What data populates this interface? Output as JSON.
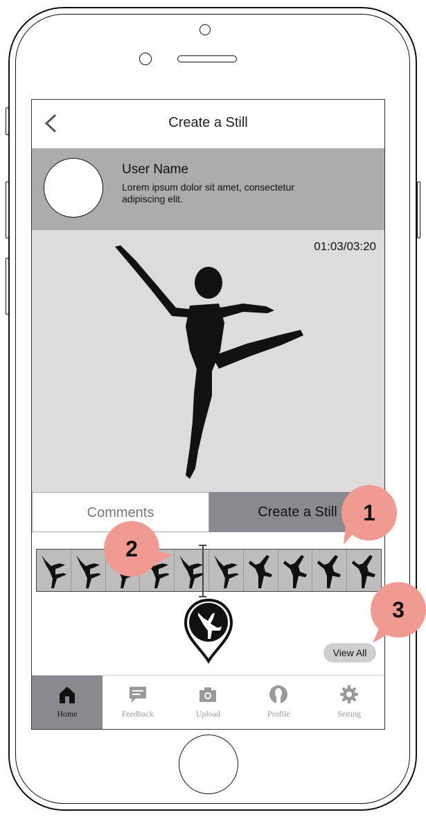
{
  "nav": {
    "title": "Create a Still",
    "back_icon": "chevron-left-icon"
  },
  "user": {
    "name": "User Name",
    "description": "Lorem ipsum dolor sit amet, consectetur adipiscing elit."
  },
  "video": {
    "timestamp": "01:03/03:20"
  },
  "tabs": [
    {
      "label": "Comments",
      "active": false
    },
    {
      "label": "Create a Still",
      "active": true
    }
  ],
  "filmstrip": {
    "frame_count": 10
  },
  "view_all": {
    "label": "View All"
  },
  "tabbar": [
    {
      "label": "Home",
      "icon": "home-icon",
      "active": true
    },
    {
      "label": "Feedback",
      "icon": "chat-bubble-icon",
      "active": false
    },
    {
      "label": "Upload",
      "icon": "camera-icon",
      "active": false
    },
    {
      "label": "Profile",
      "icon": "person-icon",
      "active": false
    },
    {
      "label": "Setting",
      "icon": "gear-icon",
      "active": false
    }
  ],
  "callouts": {
    "one": "1",
    "two": "2",
    "three": "3"
  },
  "colors": {
    "accent_tab": "#8a8a8e",
    "user_band": "#acacac",
    "video_bg": "#dcdcdc",
    "callout": "#f09a92"
  }
}
